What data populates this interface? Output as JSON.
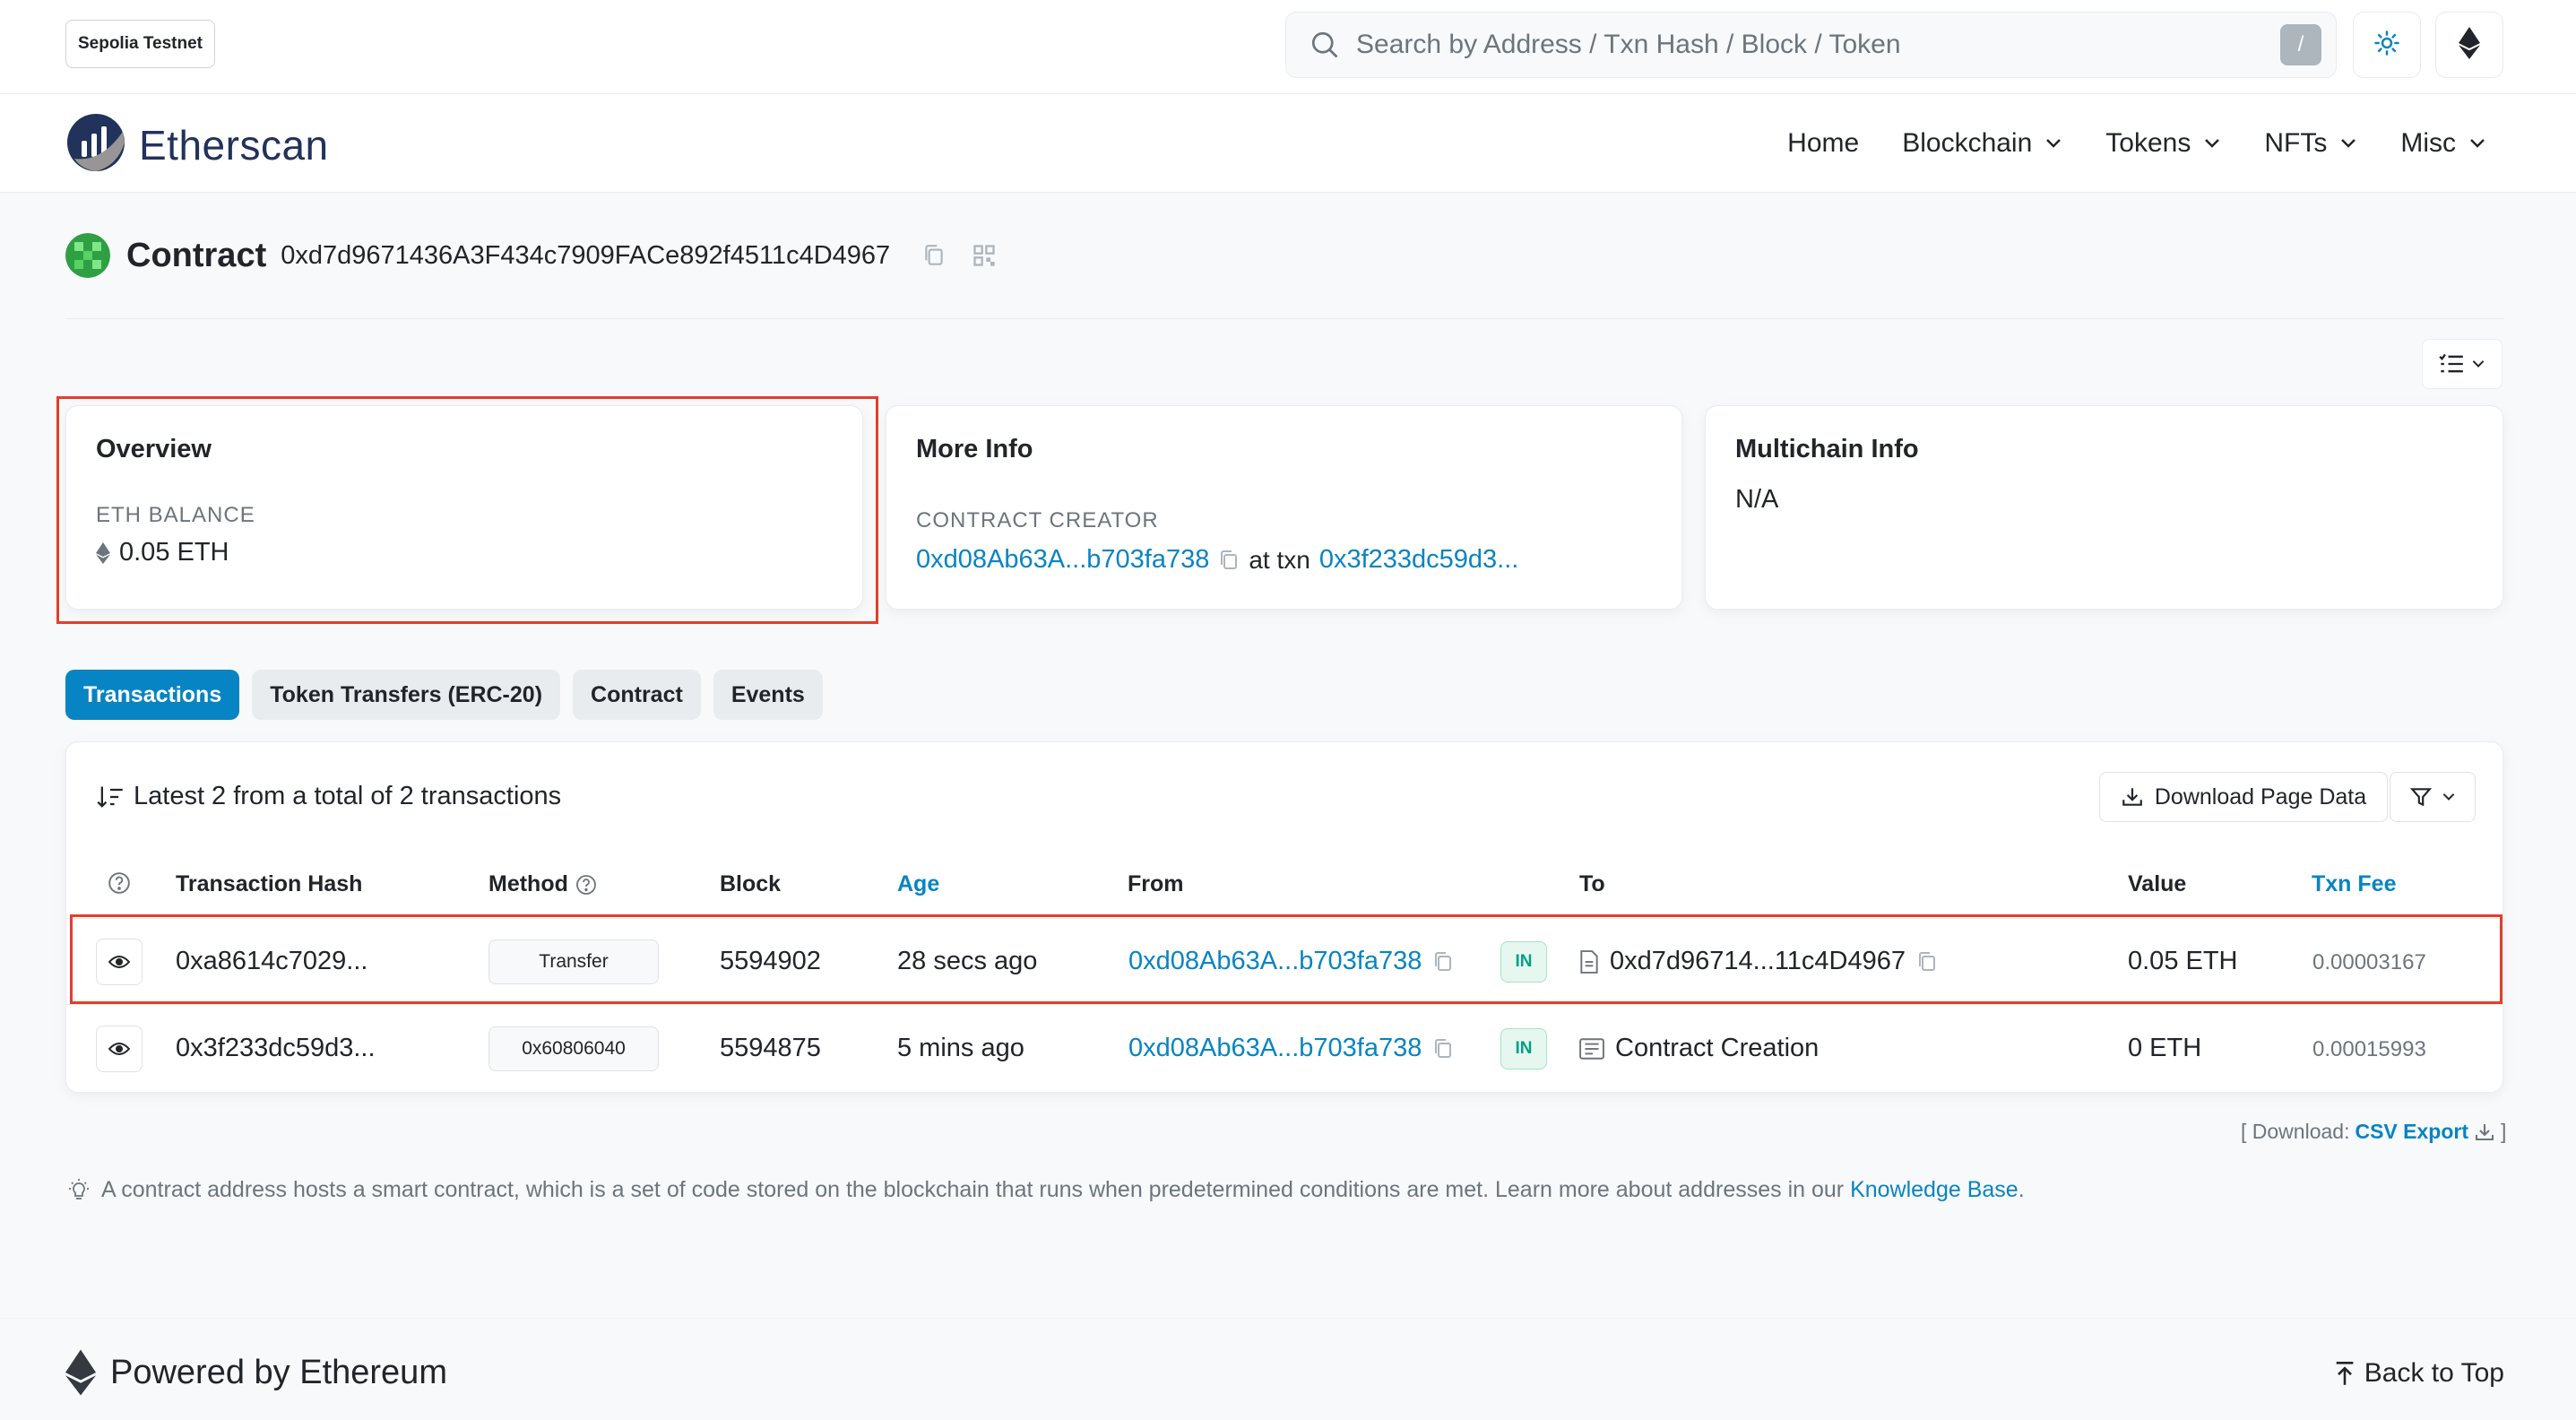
{
  "network": "Sepolia Testnet",
  "search": {
    "placeholder": "Search by Address / Txn Hash / Block / Token",
    "shortcut": "/"
  },
  "brand": {
    "name": "Etherscan"
  },
  "nav": {
    "home": "Home",
    "blockchain": "Blockchain",
    "tokens": "Tokens",
    "nfts": "NFTs",
    "misc": "Misc"
  },
  "contract": {
    "label": "Contract",
    "address": "0xd7d9671436A3F434c7909FACe892f4511c4D4967"
  },
  "overview": {
    "title": "Overview",
    "balance_label": "ETH BALANCE",
    "balance_value": "0.05 ETH"
  },
  "more_info": {
    "title": "More Info",
    "creator_label": "CONTRACT CREATOR",
    "creator_address": "0xd08Ab63A...b703fa738",
    "at_txn_label": "at txn",
    "creator_txn": "0x3f233dc59d3..."
  },
  "multichain": {
    "title": "Multichain Info",
    "value": "N/A"
  },
  "tabs": [
    {
      "label": "Transactions",
      "active": true
    },
    {
      "label": "Token Transfers (ERC-20)",
      "active": false
    },
    {
      "label": "Contract",
      "active": false
    },
    {
      "label": "Events",
      "active": false
    }
  ],
  "txn_table": {
    "summary": "Latest 2 from a total of 2 transactions",
    "download_label": "Download Page Data",
    "headers": {
      "hash": "Transaction Hash",
      "method": "Method",
      "block": "Block",
      "age": "Age",
      "from": "From",
      "to": "To",
      "value": "Value",
      "fee": "Txn Fee"
    },
    "rows": [
      {
        "hash": "0xa8614c7029...",
        "method": "Transfer",
        "block": "5594902",
        "age": "28 secs ago",
        "from": "0xd08Ab63A...b703fa738",
        "direction": "IN",
        "to": "0xd7d96714...11c4D4967",
        "value": "0.05 ETH",
        "fee": "0.00003167"
      },
      {
        "hash": "0x3f233dc59d3...",
        "method": "0x60806040",
        "block": "5594875",
        "age": "5 mins ago",
        "from": "0xd08Ab63A...b703fa738",
        "direction": "IN",
        "to": "Contract Creation",
        "value": "0 ETH",
        "fee": "0.00015993"
      }
    ]
  },
  "csv": {
    "prefix": "[ Download:",
    "link": "CSV Export",
    "suffix": "]"
  },
  "note": {
    "text": "A contract address hosts a smart contract, which is a set of code stored on the blockchain that runs when predetermined conditions are met. Learn more about addresses in our",
    "link": "Knowledge Base",
    "end": "."
  },
  "footer": {
    "powered": "Powered by Ethereum",
    "back_to_top": "Back to Top"
  },
  "colors": {
    "primary": "#0784c3",
    "highlight": "#e0402a",
    "brand_dark": "#21325b"
  }
}
